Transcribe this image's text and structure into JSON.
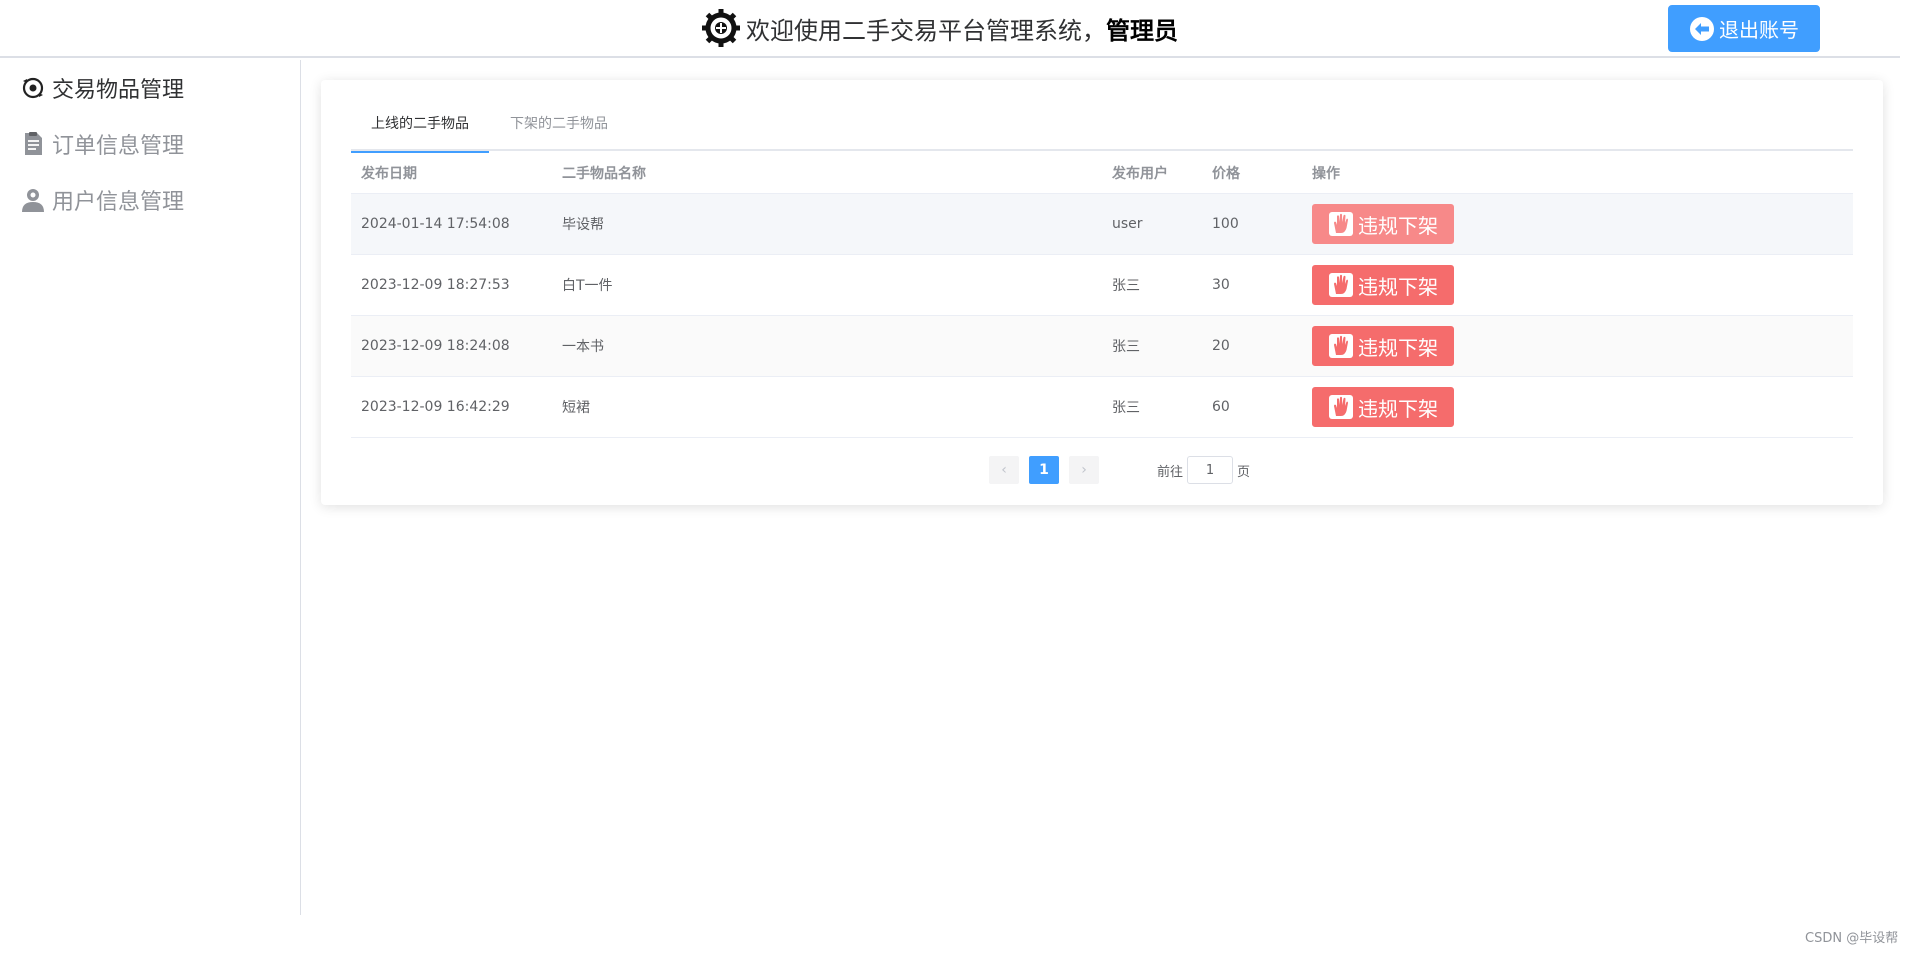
{
  "header": {
    "welcome_text": "欢迎使用二手交易平台管理系统，",
    "user_name": "管理员",
    "logout_label": "退出账号"
  },
  "sidebar": {
    "items": [
      {
        "label": "交易物品管理",
        "icon": "item-icon"
      },
      {
        "label": "订单信息管理",
        "icon": "document-icon"
      },
      {
        "label": "用户信息管理",
        "icon": "user-icon"
      }
    ]
  },
  "tabs": [
    {
      "label": "上线的二手物品"
    },
    {
      "label": "下架的二手物品"
    }
  ],
  "table": {
    "headers": [
      "发布日期",
      "二手物品名称",
      "发布用户",
      "价格",
      "操作"
    ],
    "rows": [
      {
        "date": "2024-01-14 17:54:08",
        "name": "毕设帮",
        "user": "user",
        "price": "100",
        "action": "违规下架"
      },
      {
        "date": "2023-12-09 18:27:53",
        "name": "白T一件",
        "user": "张三",
        "price": "30",
        "action": "违规下架"
      },
      {
        "date": "2023-12-09 18:24:08",
        "name": "一本书",
        "user": "张三",
        "price": "20",
        "action": "违规下架"
      },
      {
        "date": "2023-12-09 16:42:29",
        "name": "短裙",
        "user": "张三",
        "price": "60",
        "action": "违规下架"
      }
    ]
  },
  "pagination": {
    "current_page": "1",
    "goto_prefix": "前往",
    "goto_value": "1",
    "goto_suffix": "页",
    "prev_icon": "‹",
    "next_icon": "›"
  },
  "watermark": "CSDN @毕设帮",
  "colors": {
    "primary": "#409eff",
    "danger": "#f56c6c",
    "danger_light": "#f78989"
  }
}
